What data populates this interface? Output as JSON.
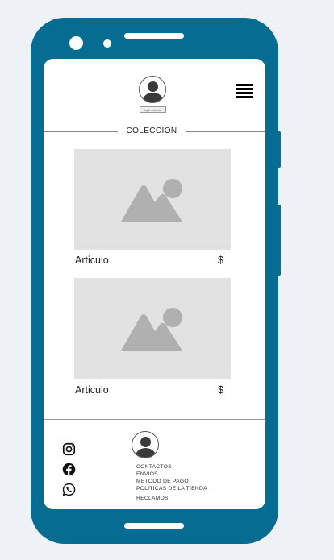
{
  "header": {
    "login_label": "login / cuenta",
    "menu_icon": "hamburger-menu-icon"
  },
  "collection": {
    "title": "COLECCION"
  },
  "products": [
    {
      "name": "Articulo",
      "price": "$",
      "image_icon": "image-placeholder-icon"
    },
    {
      "name": "Articulo",
      "price": "$",
      "image_icon": "image-placeholder-icon"
    }
  ],
  "footer": {
    "social_icons": [
      "instagram-icon",
      "facebook-icon",
      "whatsapp-icon"
    ],
    "links": [
      "CONTACTOS",
      "ENVIOS",
      "METODO DE PAGO",
      "POLITICAS DE LA TIENDA",
      "RECLAMOS"
    ]
  },
  "colors": {
    "phone_frame": "#066c92",
    "background": "#eef1f6",
    "image_placeholder": "#e2e2e2",
    "image_glyph": "#b0b0b0"
  }
}
